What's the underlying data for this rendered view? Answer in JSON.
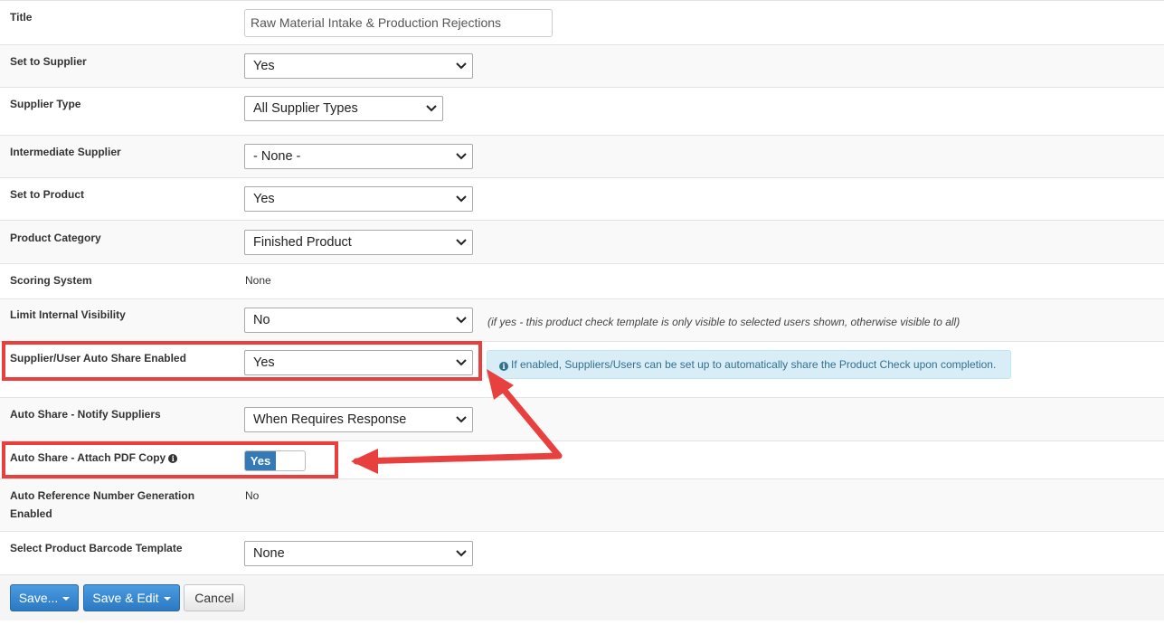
{
  "fields": {
    "title": {
      "label": "Title",
      "value": "Raw Material Intake & Production Rejections"
    },
    "set_to_supplier": {
      "label": "Set to Supplier",
      "value": "Yes"
    },
    "supplier_type": {
      "label": "Supplier Type",
      "value": "All Supplier Types"
    },
    "intermediate_supplier": {
      "label": "Intermediate Supplier",
      "value": "- None -"
    },
    "set_to_product": {
      "label": "Set to Product",
      "value": "Yes"
    },
    "product_category": {
      "label": "Product Category",
      "value": "Finished Product"
    },
    "scoring_system": {
      "label": "Scoring System",
      "value": "None"
    },
    "limit_internal_visibility": {
      "label": "Limit Internal Visibility",
      "value": "No",
      "hint": "(if yes - this product check template is only visible to selected users shown, otherwise visible to all)"
    },
    "auto_share_enabled": {
      "label": "Supplier/User Auto Share Enabled",
      "value": "Yes",
      "alert": "If enabled, Suppliers/Users can be set up to automatically share the Product Check upon completion."
    },
    "notify_suppliers": {
      "label": "Auto Share - Notify Suppliers",
      "value": "When Requires Response"
    },
    "attach_pdf": {
      "label": "Auto Share - Attach PDF Copy",
      "value": "Yes"
    },
    "auto_reference": {
      "label": "Auto Reference Number Generation Enabled",
      "value": "No"
    },
    "barcode_template": {
      "label": "Select Product Barcode Template",
      "value": "None"
    }
  },
  "buttons": {
    "save": "Save...",
    "save_edit": "Save & Edit",
    "cancel": "Cancel"
  },
  "icons": {
    "info": "info-circle-icon",
    "chevron": "chevron-down-icon",
    "caret": "caret-down-icon"
  },
  "colors": {
    "highlight": "#e8403f",
    "primary": "#337ab7",
    "alert_bg": "#d9edf7"
  }
}
